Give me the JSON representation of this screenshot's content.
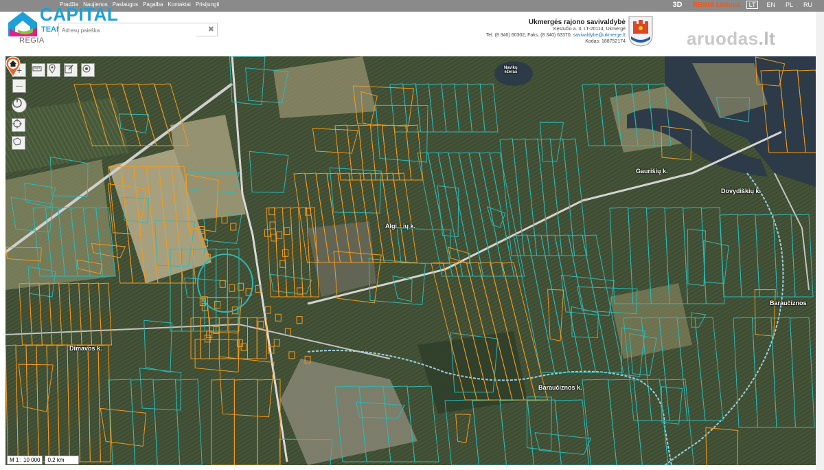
{
  "topnav": {
    "items": [
      "Pradžia",
      "Naujienos",
      "Paslaugos",
      "Pagalba",
      "Kontaktai",
      "Prisijungti"
    ],
    "mode_3d": "3D",
    "regia_link": "REGIA Lietuva",
    "languages": [
      "LT",
      "EN",
      "PL",
      "RU"
    ],
    "active_language": "LT"
  },
  "header": {
    "logo_text": "CAPITAL",
    "logo_sub": "TEAM",
    "brand": "REGIA",
    "search_placeholder": "Adresų paieška",
    "search_clear": "✖",
    "aruodas_name": "aruodas",
    "aruodas_tld": ".lt"
  },
  "municipality": {
    "name": "Ukmergės rajono savivaldybė",
    "address": "Kęstučio a. 3, LT-20114, Ukmergė",
    "phone_prefix": "Tel. (8 340) 60302; Faks. (8 340) 63370,",
    "email": "savivaldybe@ukmerge.lt",
    "code": "Kodas: 188752174"
  },
  "map": {
    "controls": {
      "zoom_in": "+",
      "zoom_out": "—"
    },
    "places": [
      {
        "id": "alginu",
        "label": "Algi…ių k."
      },
      {
        "id": "dovydiskiu",
        "label": "Dovydiškių k."
      },
      {
        "id": "dimavos",
        "label": "Dimavos k."
      },
      {
        "id": "baraucinos",
        "label": "Baraučiznos k."
      },
      {
        "id": "barauciznos-right",
        "label": "Baraučiznos"
      },
      {
        "id": "dvarisku",
        "label": "Gaurišių k."
      },
      {
        "id": "navikiu",
        "label": "Navikų\nežeras"
      }
    ],
    "scale_ratio": "M 1 : 10 000",
    "scale_bar": "0.2 km",
    "colors": {
      "cadastral_teal": "#2fb8b5",
      "parcels_orange": "#f39a1e",
      "field_dark": "#3a4a2f",
      "field_light": "#b9b08a",
      "water": "#2b3c4a",
      "road": "#dcdcdc",
      "marker": "#e8642a"
    }
  }
}
